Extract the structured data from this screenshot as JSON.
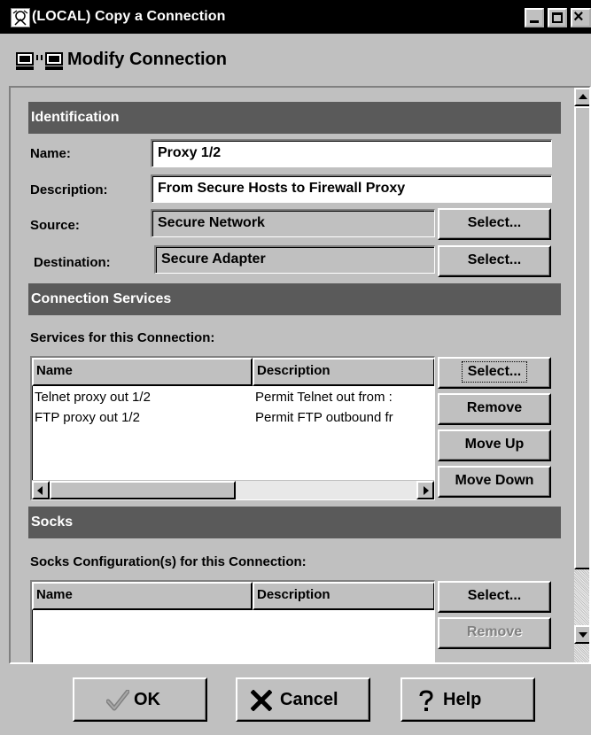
{
  "window": {
    "title": "(LOCAL) Copy a Connection",
    "icon": "app-icon",
    "controls": {
      "minimize": "minimize-icon",
      "maximize": "maximize-icon",
      "close": "×"
    }
  },
  "header": {
    "icon": "connection-icon",
    "title": "Modify Connection"
  },
  "identification": {
    "section_title": "Identification",
    "name_label": "Name:",
    "name_value": "Proxy 1/2",
    "description_label": "Description:",
    "description_value": "From Secure Hosts to Firewall Proxy",
    "source_label": "Source:",
    "source_value": "Secure Network",
    "source_select": "Select...",
    "destination_label": "Destination:",
    "destination_value": "Secure Adapter",
    "destination_select": "Select..."
  },
  "services": {
    "section_title": "Connection Services",
    "list_label": "Services for this Connection:",
    "columns": [
      "Name",
      "Description"
    ],
    "rows": [
      {
        "name": "Telnet proxy out 1/2",
        "description": "Permit Telnet out from :"
      },
      {
        "name": "FTP proxy out 1/2",
        "description": "Permit FTP outbound fr"
      }
    ],
    "buttons": {
      "select": "Select...",
      "remove": "Remove",
      "move_up": "Move Up",
      "move_down": "Move Down"
    }
  },
  "socks": {
    "section_title": "Socks",
    "list_label": "Socks Configuration(s) for this Connection:",
    "columns": [
      "Name",
      "Description"
    ],
    "rows": [],
    "buttons": {
      "select": "Select...",
      "remove": "Remove"
    }
  },
  "footer": {
    "ok": "OK",
    "cancel": "Cancel",
    "help": "Help"
  },
  "colors": {
    "face": "#c0c0c0",
    "section_bar": "#5a5a5a",
    "titlebar": "#000000"
  }
}
